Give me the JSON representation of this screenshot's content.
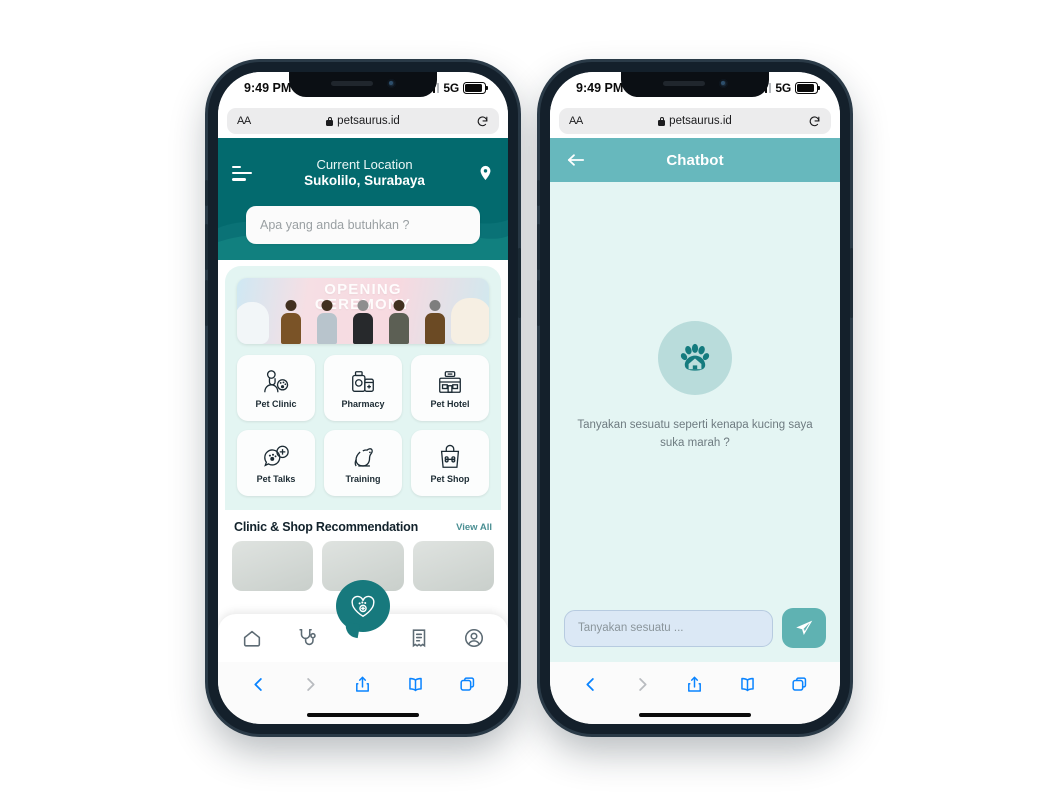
{
  "theme": {
    "home_header_teal": "#036a6e",
    "chat_header_teal": "#67b8bd",
    "mint_bg": "#e4f5f3",
    "accent": "#17797d",
    "safari_blue": "#0a84ff"
  },
  "status_bar": {
    "time": "9:49 PM",
    "network": "5G",
    "signal_icon": "cellular-bars-icon",
    "battery_icon": "battery-icon"
  },
  "safari": {
    "text_size_label": "AA",
    "lock_icon": "lock-icon",
    "url": "petsaurus.id",
    "reload_icon": "reload-icon",
    "toolbar": {
      "back_icon": "chevron-left-icon",
      "forward_icon": "chevron-right-icon",
      "share_icon": "share-icon",
      "bookmarks_icon": "book-icon",
      "tabs_icon": "tabs-icon"
    }
  },
  "home": {
    "menu_icon": "hamburger-menu-icon",
    "location_label": "Current Location",
    "location_value": "Sukolilo, Surabaya",
    "pin_icon": "map-pin-icon",
    "search_placeholder": "Apa yang anda butuhkan ?",
    "banner": {
      "title_line1": "OPENING",
      "title_line2": "CEREMONY",
      "alt": "opening-ceremony-photo"
    },
    "categories": [
      {
        "label": "Pet Clinic",
        "icon": "vet-doctor-icon"
      },
      {
        "label": "Pharmacy",
        "icon": "medicine-bottles-icon"
      },
      {
        "label": "Pet Hotel",
        "icon": "pet-hotel-building-icon"
      },
      {
        "label": "Pet Talks",
        "icon": "chat-paw-icon"
      },
      {
        "label": "Training",
        "icon": "sitting-dog-icon"
      },
      {
        "label": "Pet Shop",
        "icon": "shopping-bag-bone-icon"
      }
    ],
    "recommendation": {
      "title": "Clinic & Shop Recommendation",
      "view_all": "View All"
    },
    "bottom_nav": [
      {
        "name": "home",
        "icon": "home-icon"
      },
      {
        "name": "clinic",
        "icon": "stethoscope-icon"
      },
      {
        "name": "chatbot",
        "icon": "chat-bubble-paw-heart-icon"
      },
      {
        "name": "orders",
        "icon": "receipt-icon"
      },
      {
        "name": "profile",
        "icon": "user-circle-icon"
      }
    ]
  },
  "chatbot": {
    "back_icon": "arrow-left-icon",
    "title": "Chatbot",
    "empty_icon": "paw-house-icon",
    "empty_text": "Tanyakan sesuatu seperti kenapa kucing saya suka marah ?",
    "input_placeholder": "Tanyakan sesuatu ...",
    "send_icon": "send-paper-plane-icon"
  }
}
